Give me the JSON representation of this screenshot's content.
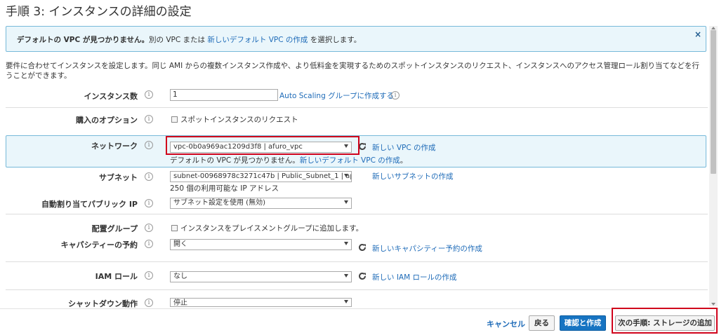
{
  "page_title": "手順 3: インスタンスの詳細の設定",
  "alert": {
    "bold": "デフォルトの VPC が見つかりません。",
    "text1": "別の VPC または ",
    "link": "新しいデフォルト VPC の作成",
    "text2": " を選択します。",
    "close_glyph": "×"
  },
  "intro": "要件に合わせてインスタンスを設定します。同じ AMI からの複数インスタンス作成や、より低料金を実現するためのスポットインスタンスのリクエスト、インスタンスへのアクセス管理ロール割り当てなどを行うことができます。",
  "info_glyph": "i",
  "instances": {
    "label": "インスタンス数",
    "value": "1",
    "link": "Auto Scaling グループに作成する"
  },
  "purchase": {
    "label": "購入のオプション",
    "checkbox_label": "スポットインスタンスのリクエスト"
  },
  "network": {
    "label": "ネットワーク",
    "value": "vpc-0b0a969ac1209d3f8 | afuro_vpc",
    "link": "新しい VPC の作成",
    "helper_text": "デフォルトの VPC が見つかりません。",
    "helper_link": "新しいデフォルト VPC の作成",
    "helper_end": "。"
  },
  "subnet": {
    "label": "サブネット",
    "value": "subnet-00968978c3271c47b | Public_Subnet_1 | ap-",
    "link": "新しいサブネットの作成",
    "helper": "250 個の利用可能な IP アドレス"
  },
  "public_ip": {
    "label": "自動割り当てパブリック IP",
    "value": "サブネット設定を使用 (無効)"
  },
  "placement": {
    "label": "配置グループ",
    "checkbox_label": "インスタンスをプレイスメントグループに追加します。"
  },
  "capacity": {
    "label": "キャパシティーの予約",
    "value": "開く",
    "link": "新しいキャパシティー予約の作成"
  },
  "iam": {
    "label": "IAM ロール",
    "value": "なし",
    "link": "新しい IAM ロールの作成"
  },
  "shutdown": {
    "label": "シャットダウン動作",
    "value": "停止"
  },
  "footer": {
    "cancel": "キャンセル",
    "back": "戻る",
    "review": "確認と作成",
    "next": "次の手順: ストレージの追加"
  },
  "colors": {
    "link": "#1e6bb8",
    "primary": "#1774c2",
    "highlight": "#d0021b",
    "info_bg": "#eaf6fb"
  }
}
